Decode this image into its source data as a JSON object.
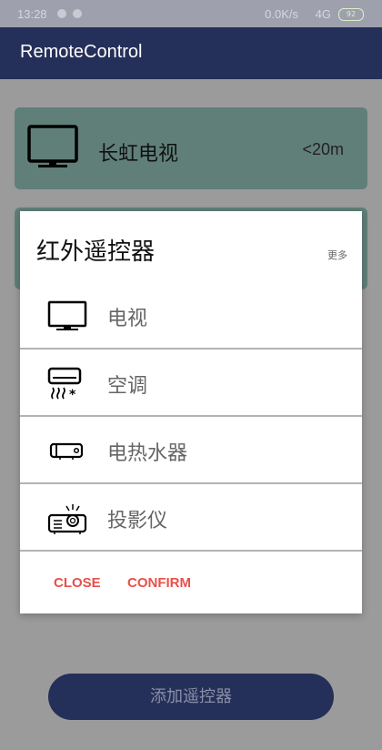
{
  "status_bar": {
    "time": "13:28",
    "network": "0.0K/s",
    "signal": "4G",
    "battery": "92"
  },
  "app_bar": {
    "title": "RemoteControl"
  },
  "device_card": {
    "name": "长虹电视",
    "distance": "<20m"
  },
  "add_button": {
    "label": "添加遥控器"
  },
  "dialog": {
    "title": "红外遥控器",
    "more": "更多",
    "options": [
      {
        "label": "电视",
        "icon": "tv-icon"
      },
      {
        "label": "空调",
        "icon": "air-conditioner-icon"
      },
      {
        "label": "电热水器",
        "icon": "water-heater-icon"
      },
      {
        "label": "投影仪",
        "icon": "projector-icon"
      }
    ],
    "close_label": "CLOSE",
    "confirm_label": "CONFIRM"
  },
  "colors": {
    "primary": "#25305a",
    "card": "#607f78",
    "accent": "#e8504a"
  }
}
